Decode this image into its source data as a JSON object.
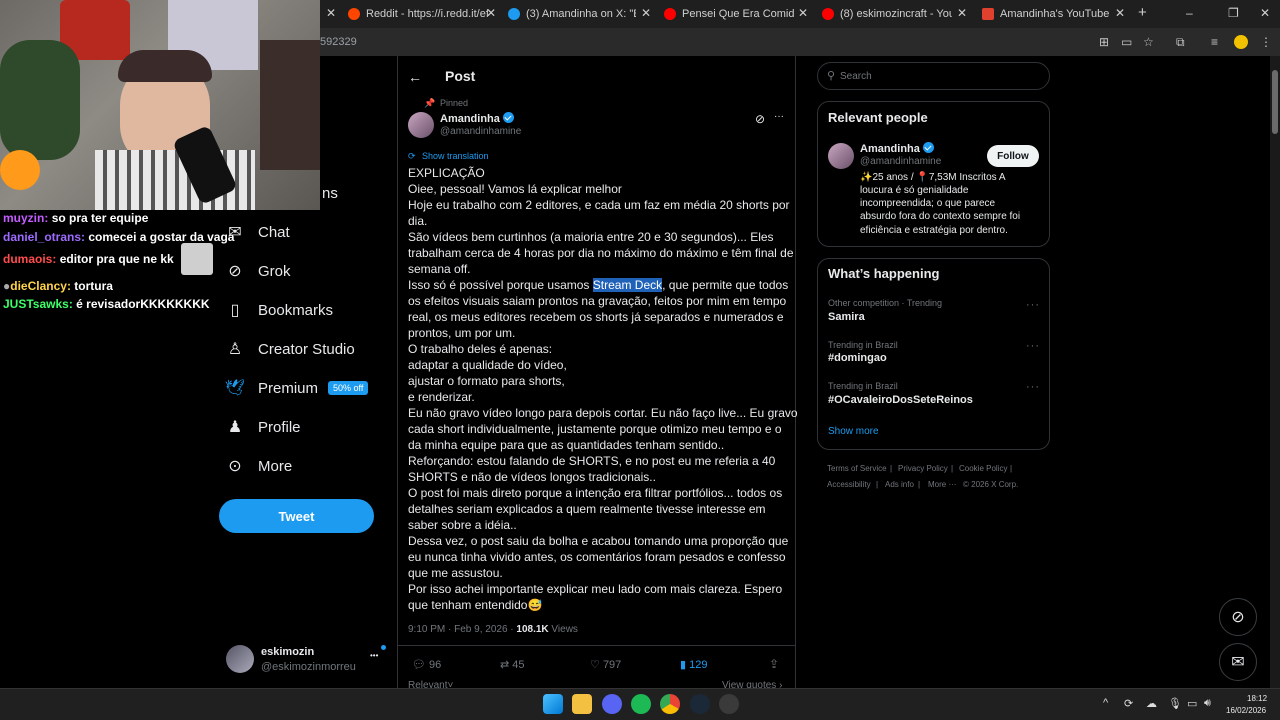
{
  "browser": {
    "tabs": [
      {
        "label": "Reddit - https://i.redd.it/efvu9c",
        "color": "#ff4500"
      },
      {
        "label": "(3) Amandinha on X: \"EXPLICAÇ",
        "color": "#1d9bf0"
      },
      {
        "label": "Pensei Que Era Comida #shorts",
        "color": "#ff0000"
      },
      {
        "label": "(8) eskimozincraft - YouTube",
        "color": "#ff0000"
      },
      {
        "label": "Amandinha's YouTube Statistic",
        "color": "#e0412f"
      }
    ],
    "new_tab": "+",
    "url_fragment": "592329",
    "window_min": "–",
    "window_max": "❐",
    "window_close": "✕"
  },
  "stream_chat": [
    {
      "user": "muyzin:",
      "text": "so pra ter equipe",
      "color": "#c45cff"
    },
    {
      "user": "daniel_otrans:",
      "text": "comecei a gostar da vaga",
      "color": "#9d6bff"
    },
    {
      "user": "dumaois:",
      "text": "editor pra que ne kk",
      "color": "#ff4d4d"
    },
    {
      "user": "dieClancy:",
      "text": "tortura",
      "color": "#ffd24d"
    },
    {
      "user": "JUSTsawks:",
      "text": "é revisadorKKKKKKKK",
      "color": "#3cff6a"
    }
  ],
  "sidebar": {
    "partial_item": "ns",
    "items": [
      {
        "label": "Chat",
        "icon": "mail-icon"
      },
      {
        "label": "Grok",
        "icon": "grok-icon"
      },
      {
        "label": "Bookmarks",
        "icon": "bookmark-icon"
      },
      {
        "label": "Creator Studio",
        "icon": "creator-studio-icon"
      },
      {
        "label": "Premium",
        "icon": "bird-icon"
      },
      {
        "label": "Profile",
        "icon": "profile-icon"
      },
      {
        "label": "More",
        "icon": "more-icon"
      }
    ],
    "premium_badge": "50% off",
    "tweet_button": "Tweet",
    "account": {
      "name": "eskimozin",
      "handle": "@eskimozinmorreu",
      "menu": "•••"
    }
  },
  "post": {
    "header": "Post",
    "pinned": "Pinned",
    "author": "Amandinha",
    "handle": "@amandinhamine",
    "show_translation": "Show translation",
    "body_lines": [
      "EXPLICAÇÃO",
      "Oiee, pessoal! Vamos lá explicar melhor",
      "Hoje eu trabalho com 2 editores, e cada um faz em média 20 shorts por",
      "dia.",
      "São vídeos bem curtinhos (a maioria entre 20 e 30 segundos)... Eles",
      "trabalham cerca de 4 horas por dia no máximo do máximo e têm final de",
      "semana off.",
      "",
      ", que permite que todos",
      "os efeitos visuais saiam prontos na gravação, feitos por mim em tempo",
      "real, os meus editores recebem os shorts já separados e numerados e",
      "prontos, um por um.",
      "O trabalho deles é apenas:",
      "adaptar a qualidade do vídeo,",
      "ajustar o formato para shorts,",
      "e renderizar.",
      "Eu não gravo vídeo longo para depois cortar. Eu não faço live... Eu gravo",
      "cada short individualmente, justamente porque otimizo meu tempo e o",
      "da minha equipe para que as quantidades tenham sentido..",
      "Reforçando: estou falando de SHORTS, e no post eu me referia a 40",
      "SHORTS e não de vídeos longos tradicionais..",
      "O post foi mais direto porque a intenção era filtrar portfólios... todos os",
      "detalhes seriam explicados a quem realmente tivesse interesse em",
      "saber sobre a idéia..",
      "Dessa vez, o post saiu da bolha e acabou tomando uma proporção que",
      "eu nunca tinha vivido antes, os comentários foram pesados e confesso",
      "que me assustou.",
      "Por isso achei importante explicar meu lado com mais clareza. Espero",
      "que tenham entendido"
    ],
    "line8_prefix": "Isso só é possível porque usamos ",
    "highlight": "Stream Deck",
    "emoji": "😅",
    "timestamp": "9:10 PM · Feb 9, 2026 · ",
    "views_count": "108.1K",
    "views_label": " Views",
    "actions": {
      "replies": "96",
      "reposts": "45",
      "likes": "797",
      "bookmarks": "129"
    },
    "relevant": "Relevant",
    "view_quotes": "View quotes"
  },
  "right": {
    "search_placeholder": "Search",
    "relevant_people_title": "Relevant people",
    "person": {
      "name": "Amandinha",
      "handle": "@amandinhamine",
      "follow": "Follow",
      "bio": [
        "✨25 anos / 📍7,53M Inscritos A",
        "loucura é só genialidade",
        "incompreendida; o que parece",
        "absurdo fora do contexto sempre foi",
        "eficiência e estratégia por dentro."
      ]
    },
    "happening_title": "What’s happening",
    "trends": [
      {
        "meta": "Other competition · Trending",
        "name": "Samira"
      },
      {
        "meta": "Trending in Brazil",
        "name": "#domingao"
      },
      {
        "meta": "Trending in Brazil",
        "name": "#OCavaleiroDosSeteReinos"
      }
    ],
    "show_more": "Show more",
    "footer_row1": [
      "Terms of Service",
      "Privacy Policy",
      "Cookie Policy"
    ],
    "footer_row2": [
      "Accessibility",
      "Ads info",
      "More ···",
      "© 2026 X Corp."
    ]
  },
  "taskbar": {
    "time": "18:12",
    "date": "16/02/2026"
  },
  "colors": {
    "accent": "#1d9bf0",
    "border": "#2f3336",
    "muted": "#71767b"
  }
}
